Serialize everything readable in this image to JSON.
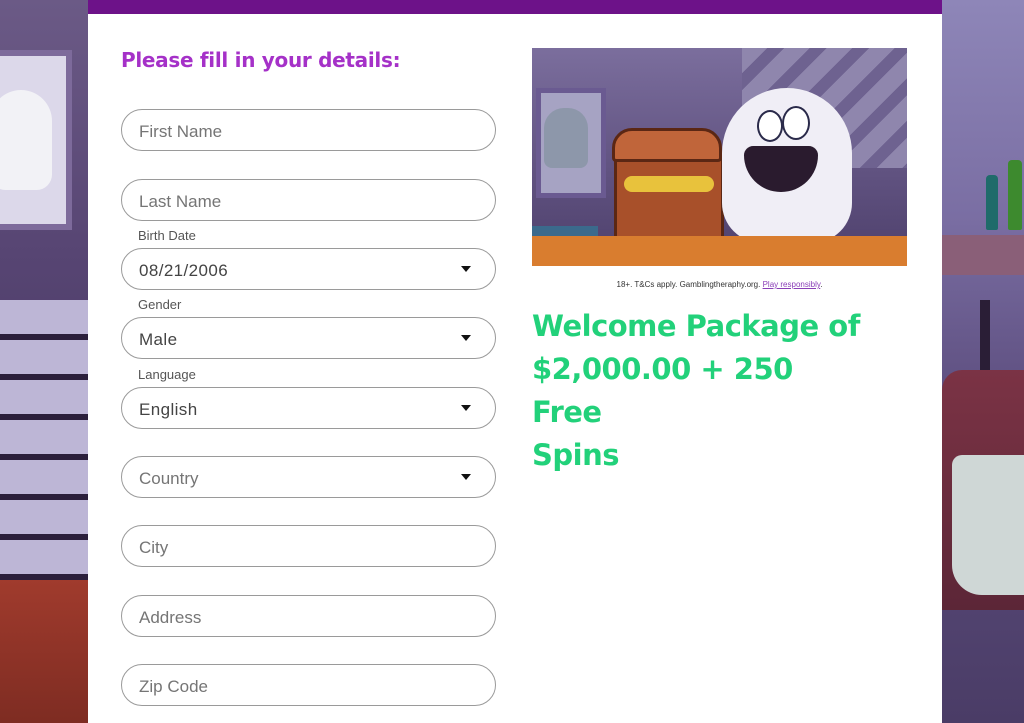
{
  "form": {
    "title": "Please fill in your details:",
    "first_name": {
      "placeholder": "First Name"
    },
    "last_name": {
      "placeholder": "Last Name"
    },
    "birth_date": {
      "label": "Birth Date",
      "value": "08/21/2006"
    },
    "gender": {
      "label": "Gender",
      "value": "Male"
    },
    "language": {
      "label": "Language",
      "value": "English"
    },
    "country": {
      "placeholder": "Country"
    },
    "city": {
      "placeholder": "City"
    },
    "address": {
      "placeholder": "Address"
    },
    "zip": {
      "placeholder": "Zip Code"
    }
  },
  "promo": {
    "disclaimer_text": "18+. T&Cs apply. Gamblingtheraphy.org.",
    "disclaimer_link": "Play responsibly",
    "disclaimer_end": ".",
    "welcome_line1": "Welcome Package of",
    "welcome_line2": "$2,000.00 + 250 Free",
    "welcome_line3": "Spins"
  },
  "colors": {
    "topbar": "#6d1289",
    "title": "#a531c8",
    "welcome": "#22d17a"
  }
}
